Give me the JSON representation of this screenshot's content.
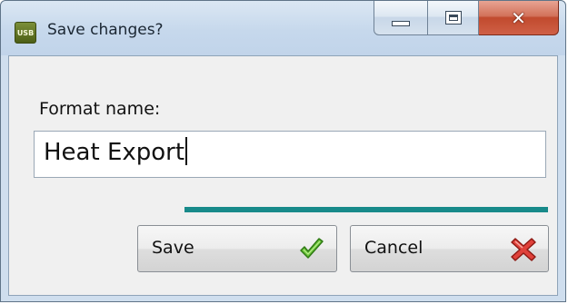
{
  "window": {
    "title": "Save changes?",
    "app_icon_text": "USB",
    "accent_color": "#188a8a"
  },
  "form": {
    "label": "Format name:",
    "value": "Heat Export"
  },
  "buttons": {
    "save_label": "Save",
    "save_icon": "checkmark-icon",
    "cancel_label": "Cancel",
    "cancel_icon": "red-x-icon"
  }
}
